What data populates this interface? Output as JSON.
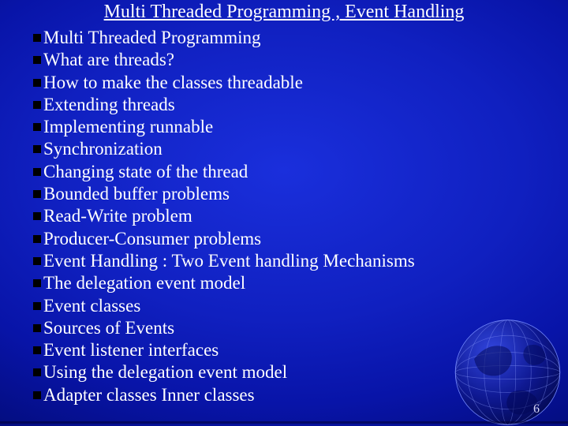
{
  "title": "Multi Threaded Programming , Event Handling",
  "bullets": [
    "Multi Threaded Programming",
    "What  are threads?",
    "How to make the classes  threadable",
    "Extending threads",
    "Implementing runnable",
    "Synchronization",
    "Changing state of the thread",
    "Bounded buffer problems",
    "Read-Write problem",
    "Producer-Consumer problems",
    "Event Handling : Two Event handling Mechanisms",
    "The delegation event model",
    "Event classes",
    "Sources of Events",
    "Event listener interfaces",
    "Using the delegation event model",
    "Adapter classes Inner classes"
  ],
  "page_number": "6"
}
